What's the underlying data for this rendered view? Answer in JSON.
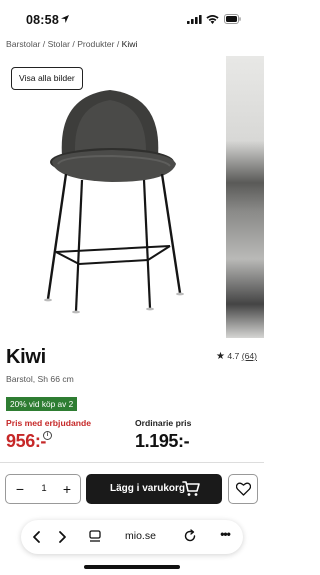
{
  "status_bar": {
    "time": "08:58"
  },
  "breadcrumb": {
    "items": [
      "Barstolar",
      "Stolar",
      "Produkter"
    ],
    "separator": " / ",
    "current": "Kiwi"
  },
  "gallery": {
    "show_all_label": "Visa alla bilder"
  },
  "product": {
    "title": "Kiwi",
    "subtitle": "Barstol, Sh 66 cm",
    "rating_value": "4.7",
    "rating_count": "(64)",
    "promo_badge": "20% vid köp av 2",
    "member_price_label": "Pris med erbjudande",
    "member_price": "956:-",
    "info_icon": "i",
    "regular_price_label": "Ordinarie pris",
    "regular_price": "1.195:-"
  },
  "purchase": {
    "quantity": "1",
    "minus": "−",
    "plus": "+",
    "add_to_cart_label": "Lägg i varukorg"
  },
  "browser": {
    "url": "mio.se",
    "more": "•••"
  },
  "colors": {
    "promo_green": "#2e7d32",
    "sale_red": "#c62828",
    "button_dark": "#1a1a1a"
  },
  "icons": [
    "location-arrow-icon",
    "signal-icon",
    "wifi-icon",
    "battery-icon",
    "star-icon",
    "info-icon",
    "cart-icon",
    "heart-icon",
    "back-icon",
    "forward-icon",
    "tabs-icon",
    "reload-icon",
    "more-icon"
  ]
}
